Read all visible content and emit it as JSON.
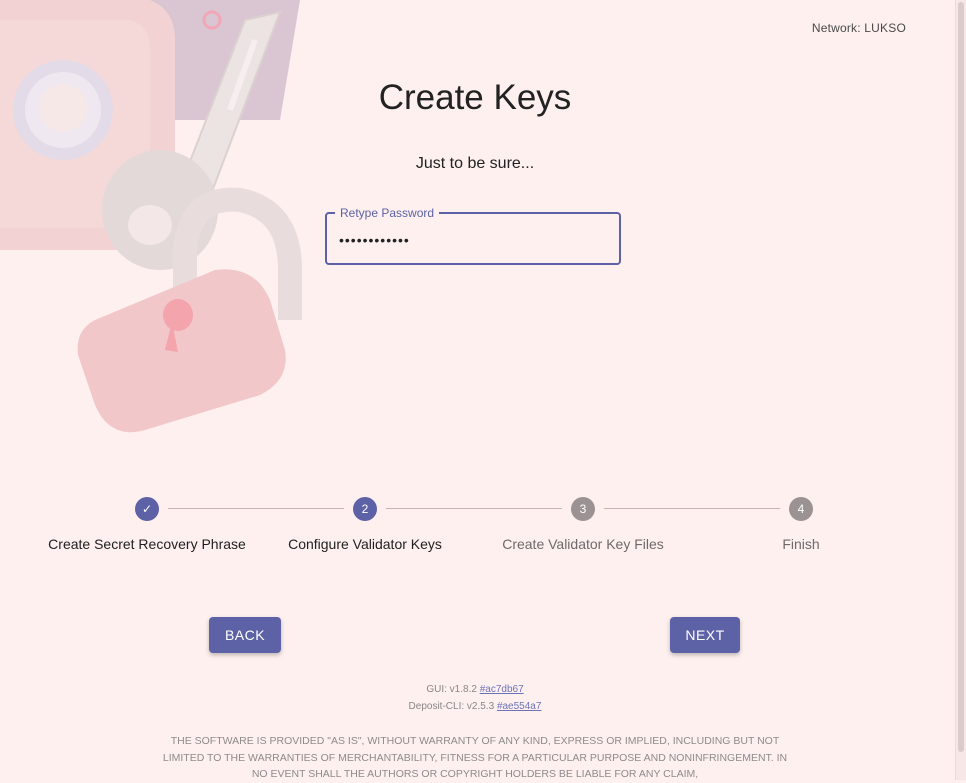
{
  "header": {
    "network_label": "Network: LUKSO"
  },
  "main": {
    "title": "Create Keys",
    "subtitle": "Just to be sure...",
    "password_field": {
      "label": "Retype Password",
      "value": "••••••••••••"
    }
  },
  "stepper": {
    "steps": [
      {
        "number": "✓",
        "label": "Create Secret Recovery Phrase",
        "state": "completed"
      },
      {
        "number": "2",
        "label": "Configure Validator Keys",
        "state": "active"
      },
      {
        "number": "3",
        "label": "Create Validator Key Files",
        "state": "inactive"
      },
      {
        "number": "4",
        "label": "Finish",
        "state": "inactive"
      }
    ]
  },
  "buttons": {
    "back_label": "BACK",
    "next_label": "NEXT"
  },
  "footer": {
    "gui_version_text": "GUI: v1.8.2",
    "gui_commit": "#ac7db67",
    "cli_version_text": "Deposit-CLI: v2.5.3",
    "cli_commit": "#ae554a7",
    "license_text": "THE SOFTWARE IS PROVIDED \"AS IS\", WITHOUT WARRANTY OF ANY KIND, EXPRESS OR IMPLIED, INCLUDING BUT NOT LIMITED TO THE WARRANTIES OF MERCHANTABILITY, FITNESS FOR A PARTICULAR PURPOSE AND NONINFRINGEMENT. IN NO EVENT SHALL THE AUTHORS OR COPYRIGHT HOLDERS BE LIABLE FOR ANY CLAIM,"
  },
  "colors": {
    "accent": "#5d62a7",
    "background": "#fdf0ef",
    "inactive_step": "#9b9393"
  }
}
